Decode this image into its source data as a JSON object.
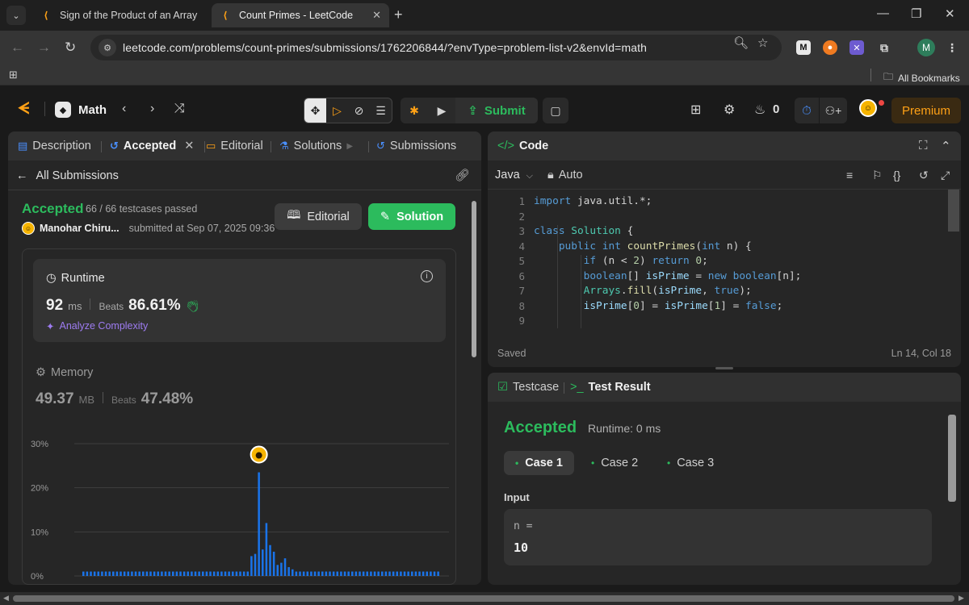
{
  "browser": {
    "tabs": [
      {
        "title": "Sign of the Product of an Array",
        "active": false
      },
      {
        "title": "Count Primes - LeetCode",
        "active": true
      }
    ],
    "url": "leetcode.com/problems/count-primes/submissions/1762206844/?envType=problem-list-v2&envId=math",
    "all_bookmarks": "All Bookmarks",
    "profile_initial": "M"
  },
  "nav": {
    "list_name": "Math",
    "submit_label": "Submit",
    "streak": "0",
    "premium": "Premium"
  },
  "left": {
    "tabs": {
      "description": "Description",
      "accepted": "Accepted",
      "editorial": "Editorial",
      "solutions": "Solutions",
      "submissions": "Submissions"
    },
    "all_submissions": "All Submissions",
    "status": "Accepted",
    "testcases": "66 / 66 testcases passed",
    "user": "Manohar Chiru...",
    "submitted": "submitted at Sep 07, 2025 09:36",
    "editorial_btn": "Editorial",
    "solution_btn": "Solution",
    "runtime": {
      "label": "Runtime",
      "value": "92",
      "unit": "ms",
      "beats_label": "Beats",
      "beats": "86.61%",
      "analyze": "Analyze Complexity"
    },
    "memory": {
      "label": "Memory",
      "value": "49.37",
      "unit": "MB",
      "beats_label": "Beats",
      "beats": "47.48%"
    }
  },
  "chart_data": {
    "type": "bar",
    "y_ticks": [
      "30%",
      "20%",
      "10%",
      "0%"
    ],
    "ylim": [
      0,
      30
    ],
    "values": [
      1,
      1,
      1,
      1,
      1,
      1,
      1,
      1,
      1,
      1,
      1,
      1,
      1,
      1,
      1,
      1,
      1,
      1,
      1,
      1,
      1,
      1,
      1,
      1,
      1,
      1,
      1,
      1,
      1,
      1,
      1,
      1,
      1,
      1,
      1,
      1,
      1,
      1,
      1,
      1,
      1,
      1,
      1,
      1,
      1,
      4.5,
      5,
      23.5,
      6,
      12,
      7,
      5.5,
      2.5,
      3,
      4,
      2,
      1.5,
      1,
      1,
      1,
      1,
      1,
      1,
      1,
      1,
      1,
      1,
      1,
      1,
      1,
      1,
      1,
      1,
      1,
      1,
      1,
      1,
      1,
      1,
      1,
      1,
      1,
      1,
      1,
      1,
      1,
      1,
      1,
      1,
      1,
      1,
      1,
      1,
      1,
      1,
      1
    ],
    "highlight_index": 47,
    "bar_color": "#1a73e8"
  },
  "code": {
    "title": "Code",
    "language": "Java",
    "mode": "Auto",
    "lines": [
      "import java.util.*;",
      "",
      "class Solution {",
      "    public int countPrimes(int n) {",
      "        if (n < 2) return 0;",
      "        boolean[] isPrime = new boolean[n];",
      "        Arrays.fill(isPrime, true);",
      "        isPrime[0] = isPrime[1] = false;",
      ""
    ],
    "saved": "Saved",
    "position": "Ln 14, Col 18"
  },
  "result": {
    "tab_testcase": "Testcase",
    "tab_result": "Test Result",
    "status": "Accepted",
    "runtime": "Runtime: 0 ms",
    "cases": [
      "Case 1",
      "Case 2",
      "Case 3"
    ],
    "input_label": "Input",
    "var_name": "n =",
    "var_value": "10"
  }
}
